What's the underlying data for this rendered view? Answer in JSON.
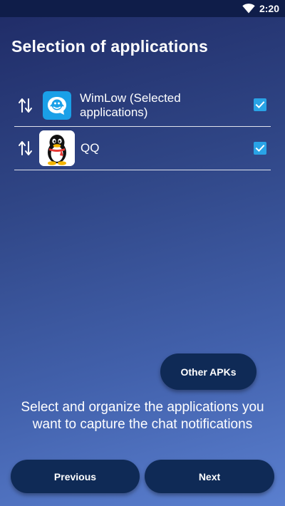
{
  "status_bar": {
    "time": "2:20",
    "icons": [
      "wifi-icon"
    ]
  },
  "page": {
    "title": "Selection of applications"
  },
  "apps": [
    {
      "name": "WimLow (Selected applications)",
      "icon": "wimlow-app-icon",
      "checked": true
    },
    {
      "name": "QQ",
      "icon": "qq-penguin-app-icon",
      "checked": true
    }
  ],
  "buttons": {
    "other_apks": "Other APKs",
    "previous": "Previous",
    "next": "Next"
  },
  "instructions": "Select and organize the applications you want to capture the chat notifications",
  "colors": {
    "status_bar": "#0f1d49",
    "button_bg": "#0f2a56",
    "checkbox": "#29a3e6",
    "wimlow_icon_bg": "#1aa0e8"
  }
}
